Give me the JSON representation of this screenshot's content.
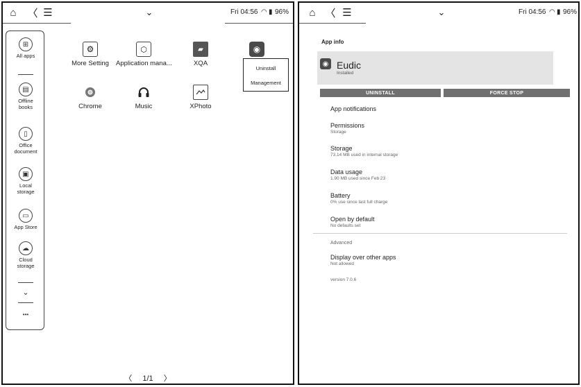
{
  "left": {
    "status": "Fri 04:56",
    "battery": "96%",
    "sidebar": [
      {
        "label": "All apps",
        "icon": "grid-icon",
        "glyph": "⊞"
      },
      {
        "label": "Offline books",
        "icon": "book-icon",
        "glyph": "▤"
      },
      {
        "label": "Office document",
        "icon": "document-icon",
        "glyph": "▯"
      },
      {
        "label": "Local storage",
        "icon": "storage-icon",
        "glyph": "▣"
      },
      {
        "label": "App Store",
        "icon": "store-icon",
        "glyph": "▭"
      },
      {
        "label": "Cloud storage",
        "icon": "cloud-icon",
        "glyph": "☁"
      }
    ],
    "more_glyph": "•••",
    "apps": [
      {
        "label": "More Setting",
        "icon": "settings-icon"
      },
      {
        "label": "Application mana...",
        "icon": "app-manager-icon"
      },
      {
        "label": "XQA",
        "icon": "android-icon"
      },
      {
        "label": "Chrome",
        "icon": "chrome-icon"
      },
      {
        "label": "Music",
        "icon": "headphones-icon"
      },
      {
        "label": "XPhoto",
        "icon": "photo-icon"
      }
    ],
    "popup": {
      "line1": "Uninstall",
      "line2": "Management"
    },
    "pager": {
      "prev": "〈",
      "text": "1/1",
      "next": "〉"
    }
  },
  "right": {
    "status": "Fri 04:56",
    "battery": "96%",
    "title": "App info",
    "app_name": "Eudic",
    "app_state": "Installed",
    "uninstall": "UNINSTALL",
    "force_stop": "FORCE STOP",
    "rows": [
      {
        "title": "App notifications",
        "sub": ""
      },
      {
        "title": "Permissions",
        "sub": "Storage"
      },
      {
        "title": "Storage",
        "sub": "73.14 MB used in internal storage"
      },
      {
        "title": "Data usage",
        "sub": "1.90 MB used since Feb 23"
      },
      {
        "title": "Battery",
        "sub": "0% use since last full charge"
      },
      {
        "title": "Open by default",
        "sub": "No defaults set"
      }
    ],
    "advanced": "Advanced",
    "display_over": {
      "title": "Display over other apps",
      "sub": "Not allowed"
    },
    "version": "version 7.0.6"
  }
}
